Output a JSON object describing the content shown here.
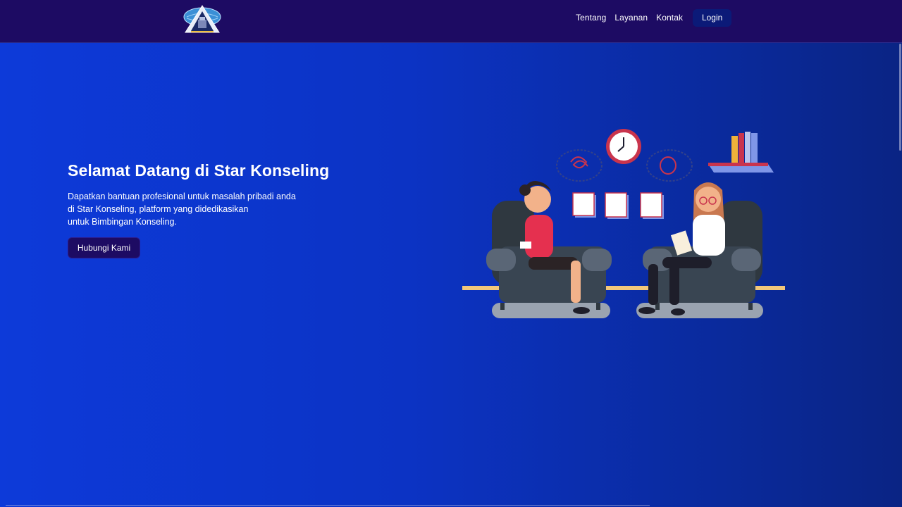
{
  "nav": {
    "logo_icon": "star-konseling-logo",
    "links": [
      "Tentang",
      "Layanan",
      "Kontak"
    ],
    "login_label": "Login"
  },
  "hero": {
    "title": "Selamat Datang di Star Konseling",
    "description_lines": [
      "Dapatkan bantuan profesional untuk masalah pribadi anda",
      "di Star Konseling, platform yang didedikasikan",
      "untuk Bimbingan Konseling."
    ],
    "cta_label": "Hubungi Kami",
    "illustration_icon": "counseling-session-illustration"
  },
  "colors": {
    "navbar_bg": "#1d0b63",
    "hero_bg_start": "#0d3ad9",
    "hero_bg_end": "#0a2484",
    "button_bg": "#1d0b63",
    "login_bg": "#0b1a78"
  }
}
